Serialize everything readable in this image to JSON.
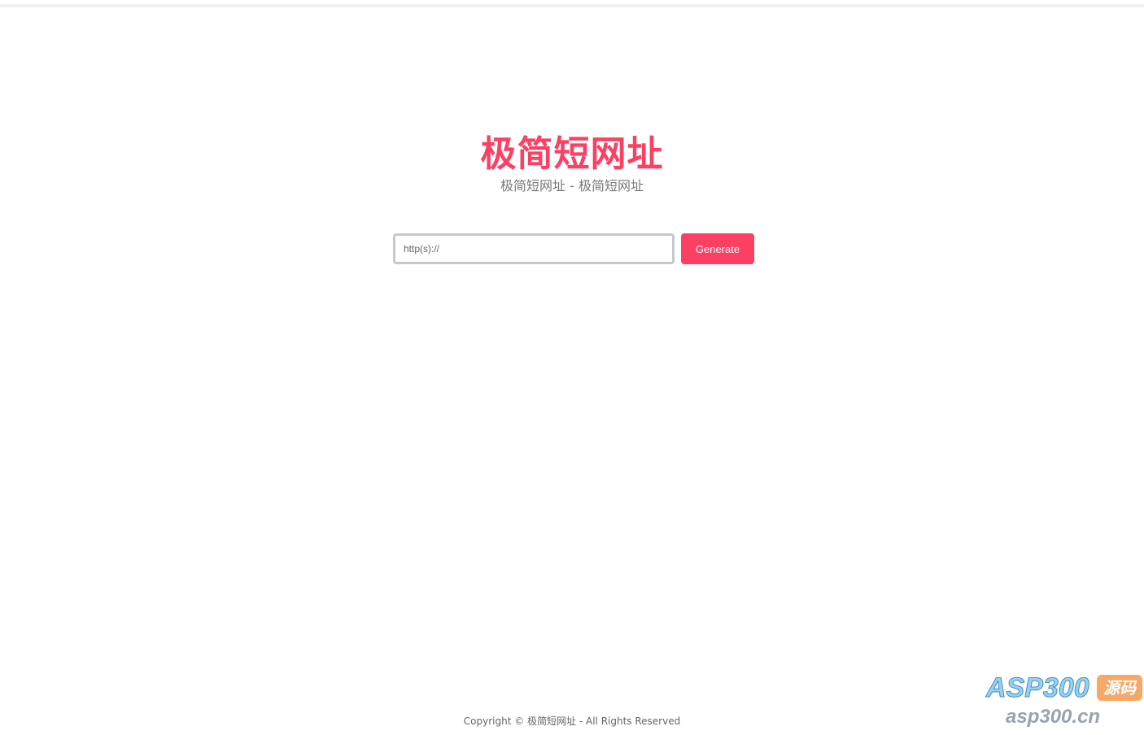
{
  "header": {
    "title": "极简短网址",
    "subtitle": "极简短网址 - 极简短网址"
  },
  "form": {
    "url_placeholder": "http(s)://",
    "url_value": "",
    "generate_label": "Generate"
  },
  "footer": {
    "copyright": "Copyright © 极简短网址 - All Rights Reserved"
  },
  "watermark": {
    "brand": "ASP300",
    "tag": "源码",
    "domain": "asp300.cn"
  },
  "colors": {
    "accent": "#fd3f63",
    "subtitle_text": "#777777",
    "input_border": "#c6c8cb",
    "top_bar": "#efefef"
  }
}
